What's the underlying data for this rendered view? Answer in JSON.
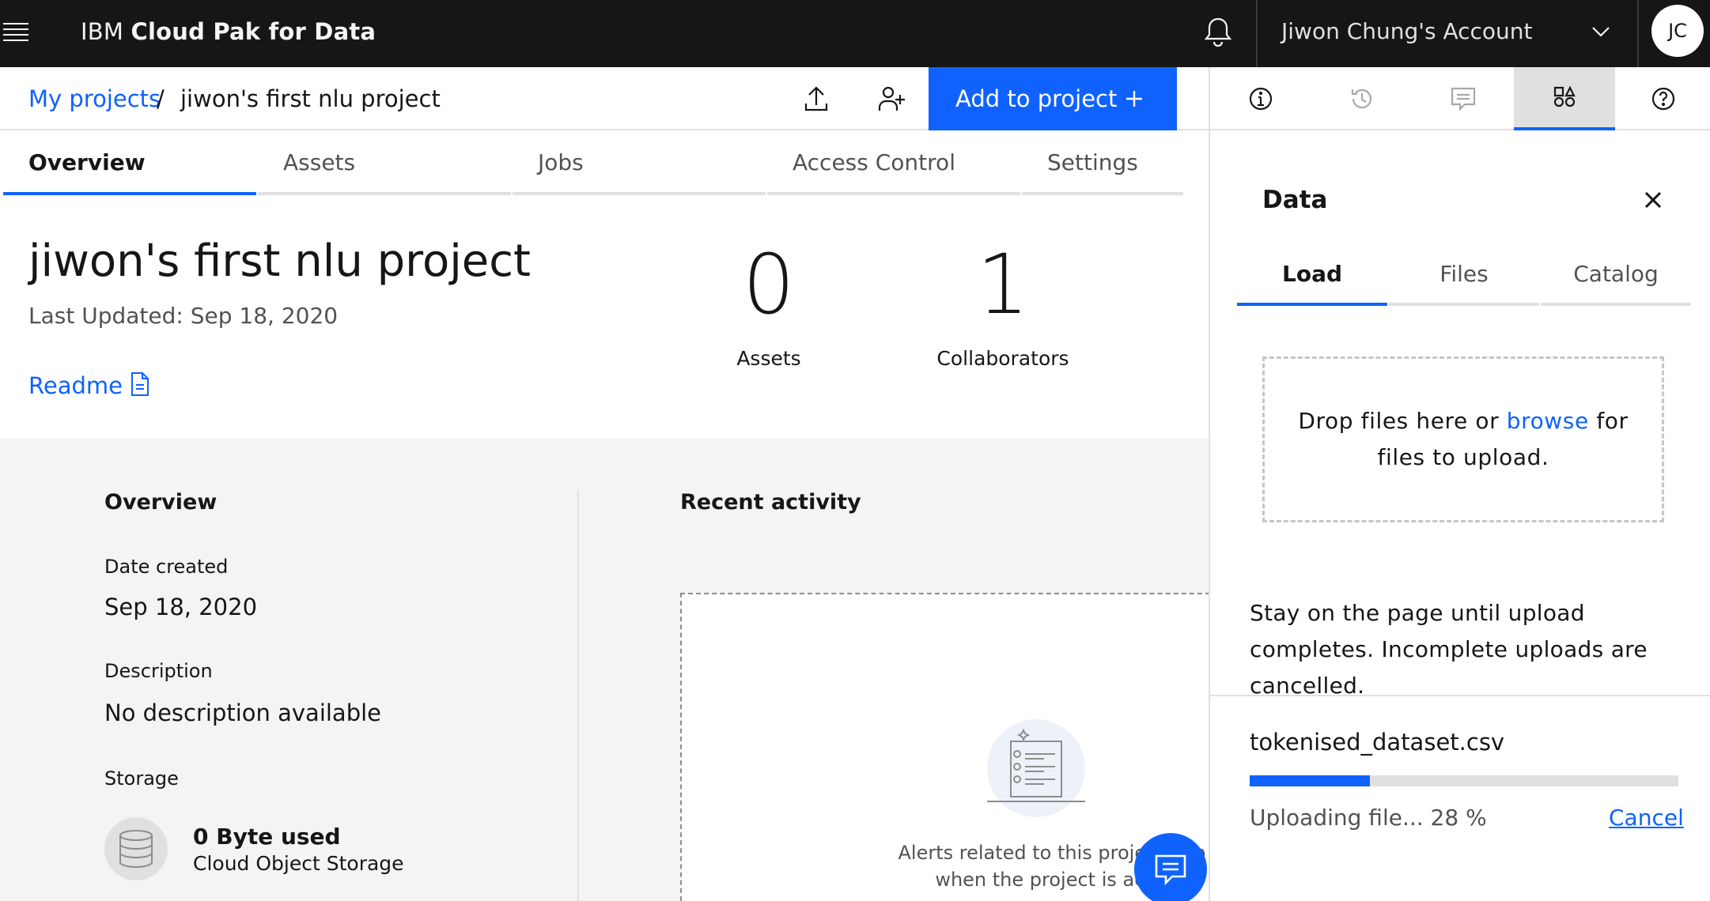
{
  "header": {
    "brand_prefix": "IBM",
    "brand_name": "Cloud Pak for Data",
    "account_name": "Jiwon Chung's Account",
    "avatar_initials": "JC"
  },
  "breadcrumb": {
    "parent": "My projects",
    "separator": "/",
    "current": "jiwon's first nlu project"
  },
  "toolbar": {
    "add_label": "Add to project"
  },
  "tabs": [
    {
      "label": "Overview",
      "active": true
    },
    {
      "label": "Assets",
      "active": false
    },
    {
      "label": "Jobs",
      "active": false
    },
    {
      "label": "Access Control",
      "active": false
    },
    {
      "label": "Settings",
      "active": false
    }
  ],
  "project": {
    "title": "jiwon's first nlu project",
    "last_updated": "Last Updated: Sep 18, 2020",
    "readme_label": "Readme",
    "stats": [
      {
        "value": "0",
        "label": "Assets"
      },
      {
        "value": "1",
        "label": "Collaborators"
      }
    ]
  },
  "overview": {
    "title": "Overview",
    "date_created_label": "Date created",
    "date_created_value": "Sep 18, 2020",
    "description_label": "Description",
    "description_value": "No description available",
    "storage_label": "Storage",
    "storage_used": "0 Byte used",
    "storage_type": "Cloud Object Storage"
  },
  "activity": {
    "title": "Recent activity",
    "empty_line1": "Alerts related to this project app",
    "empty_line2": "when the project is activ"
  },
  "panel": {
    "title": "Data",
    "tabs": [
      {
        "label": "Load",
        "active": true
      },
      {
        "label": "Files",
        "active": false
      },
      {
        "label": "Catalog",
        "active": false
      }
    ],
    "drop_before": "Drop files here or ",
    "drop_link": "browse",
    "drop_after": " for files to upload.",
    "stay_note": "Stay on the page until upload completes. Incomplete uploads are cancelled.",
    "file_name": "tokenised_dataset.csv",
    "upload_status": "Uploading file... 28 %",
    "upload_progress": 0.28,
    "cancel_label": "Cancel"
  },
  "colors": {
    "accent": "#0f62fe",
    "header_bg": "#161616",
    "body_grey": "#f4f4f4"
  },
  "icons": [
    "menu-icon",
    "notification-icon",
    "chevron-down-icon",
    "upload-icon",
    "add-user-icon",
    "add-icon",
    "document-icon",
    "information-icon",
    "history-icon",
    "comment-icon",
    "data-icon",
    "help-icon",
    "close-icon",
    "storage-icon",
    "chat-icon"
  ]
}
